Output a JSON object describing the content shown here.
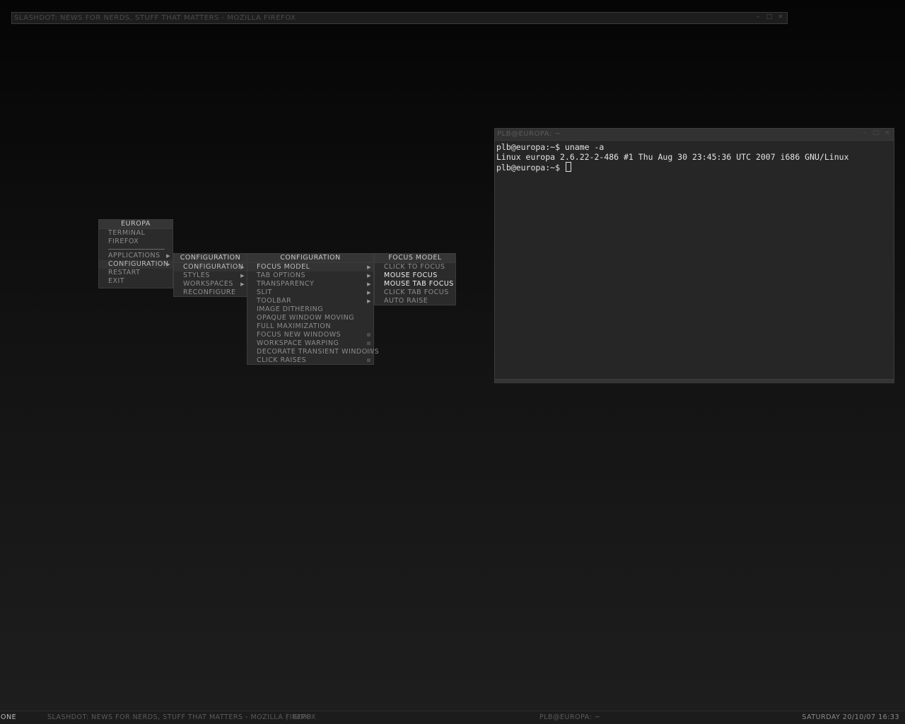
{
  "firefox_window": {
    "title": "Slashdot: News for nerds, stuff that matters - Mozilla Firefox",
    "buttons": [
      "–",
      "□",
      "×"
    ]
  },
  "terminal_window": {
    "title": "plb@europa: ~",
    "buttons": [
      "–",
      "□",
      "×"
    ],
    "lines": [
      "plb@europa:~$ uname -a",
      "Linux europa 2.6.22-2-486 #1 Thu Aug 30 23:45:36 UTC 2007 i686 GNU/Linux",
      "plb@europa:~$ "
    ]
  },
  "root_menu": {
    "title": "Europa",
    "items": [
      "Terminal",
      "Firefox"
    ],
    "items2": [
      "Applications",
      "Configuration",
      "Restart",
      "Exit"
    ]
  },
  "config_menu": {
    "title": "Configuration",
    "items": [
      "Configuration",
      "Styles",
      "Workspaces",
      "Reconfigure"
    ]
  },
  "config_submenu": {
    "title": "Configuration",
    "items": [
      "Focus Model",
      "Tab Options",
      "Transparency",
      "Slit",
      "Toolbar",
      "Image Dithering",
      "Opaque Window Moving",
      "Full Maximization",
      "Focus New Windows",
      "Workspace Warping",
      "Decorate Transient Windows",
      "Click Raises"
    ]
  },
  "focus_menu": {
    "title": "Focus Model",
    "items": [
      "Click To Focus",
      "Mouse Focus",
      "Mouse Tab Focus",
      "Click Tab Focus",
      "Auto Raise"
    ]
  },
  "toolbar": {
    "workspace": "One",
    "tasks": [
      "Slashdot: News for nerds, stuff that matters - Mozilla Firefox",
      "Gimp",
      "plb@europa: ~"
    ],
    "clock": "Saturday 20/10/07 16:33"
  }
}
